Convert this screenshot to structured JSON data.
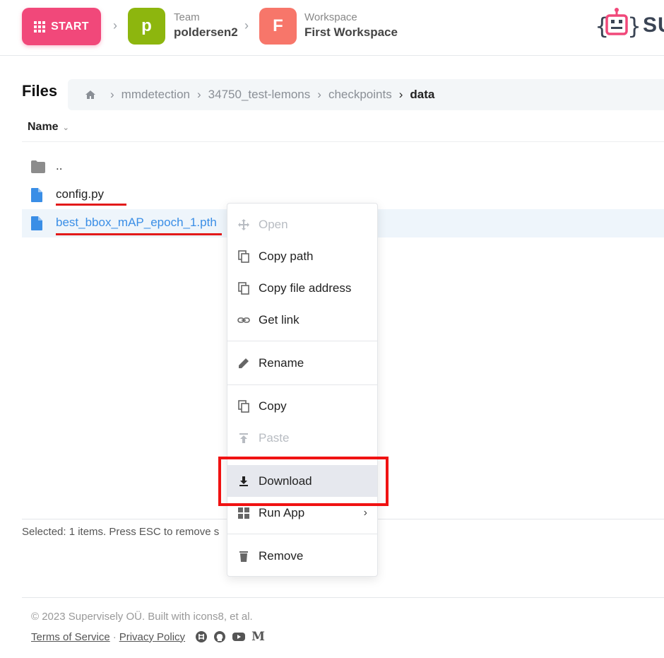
{
  "header": {
    "start_label": "START",
    "team_initial": "p",
    "team_label": "Team",
    "team_name": "poldersen2",
    "workspace_initial": "F",
    "workspace_label": "Workspace",
    "workspace_name": "First Workspace",
    "logo_text": "SU"
  },
  "files": {
    "title": "Files",
    "breadcrumb": [
      "mmdetection",
      "34750_test-lemons",
      "checkpoints",
      "data"
    ],
    "column_name": "Name",
    "rows": [
      {
        "name": "..",
        "type": "folder-icon"
      },
      {
        "name": "config.py",
        "type": "file-icon"
      },
      {
        "name": "best_bbox_mAP_epoch_1.pth",
        "type": "file-icon",
        "selected": true
      }
    ],
    "selected_note": "Selected: 1 items. Press ESC to remove s"
  },
  "context_menu": {
    "open": "Open",
    "copy_path": "Copy path",
    "copy_file_address": "Copy file address",
    "get_link": "Get link",
    "rename": "Rename",
    "copy": "Copy",
    "paste": "Paste",
    "download": "Download",
    "run_app": "Run App",
    "run_app_arrow": "›",
    "remove": "Remove"
  },
  "footer": {
    "copyright": "© 2023 Supervisely OÜ. Built with icons8, et al.",
    "terms": "Terms of Service",
    "separator": "·",
    "privacy": "Privacy Policy",
    "medium": "M"
  },
  "colors": {
    "start": "#f1487a",
    "team_tile": "#8db60e",
    "workspace_tile": "#f7766a",
    "selected_text": "#3a8ee6",
    "highlight_red": "#f01212"
  }
}
